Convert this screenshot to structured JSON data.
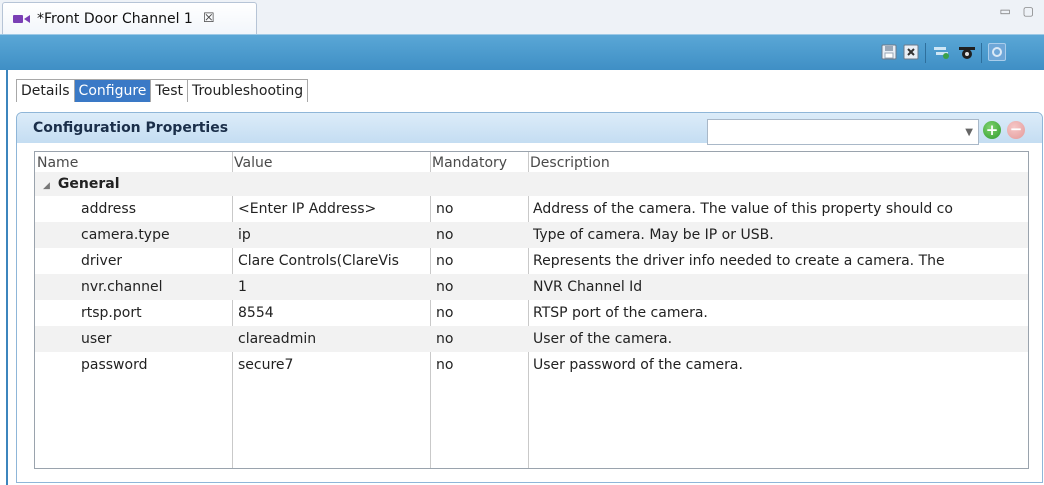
{
  "editor_tab": {
    "title": "*Front Door Channel 1",
    "close_symbol": "☒",
    "icon": "camera-icon"
  },
  "window_controls": "▭ ▢",
  "toolbar": {
    "icons": [
      "save-icon",
      "revert-icon",
      "camera-filter-icon",
      "camera-view-icon",
      "settings-icon"
    ]
  },
  "inner_tabs": [
    {
      "label": "Details",
      "active": false
    },
    {
      "label": "Configure",
      "active": true
    },
    {
      "label": "Test",
      "active": false
    },
    {
      "label": "Troubleshooting",
      "active": false
    }
  ],
  "panel": {
    "title": "Configuration Properties",
    "combo_value": "",
    "combo_arrow": "▼",
    "add_symbol": "+",
    "remove_symbol": "−"
  },
  "table": {
    "columns": [
      "Name",
      "Value",
      "Mandatory",
      "Description"
    ],
    "group": {
      "label": "General",
      "twisty": "◢"
    },
    "rows": [
      {
        "name": "address",
        "value": "<Enter IP Address>",
        "mandatory": "no",
        "description": "Address of the camera. The value of this property should co"
      },
      {
        "name": "camera.type",
        "value": "ip",
        "mandatory": "no",
        "description": "Type of camera. May be IP or USB."
      },
      {
        "name": "driver",
        "value": "Clare Controls(ClareVis",
        "mandatory": "no",
        "description": "Represents the driver info needed to create a camera. The"
      },
      {
        "name": "nvr.channel",
        "value": "1",
        "mandatory": "no",
        "description": "NVR Channel Id"
      },
      {
        "name": "rtsp.port",
        "value": "8554",
        "mandatory": "no",
        "description": "RTSP port of the camera."
      },
      {
        "name": "user",
        "value": "clareadmin",
        "mandatory": "no",
        "description": "User of the camera."
      },
      {
        "name": "password",
        "value": "secure7",
        "mandatory": "no",
        "description": "User password of the camera."
      }
    ]
  },
  "colors": {
    "accent": "#3a79c6",
    "toolbar": "#4a9ad0",
    "panel_header": "#cfe4f6"
  }
}
